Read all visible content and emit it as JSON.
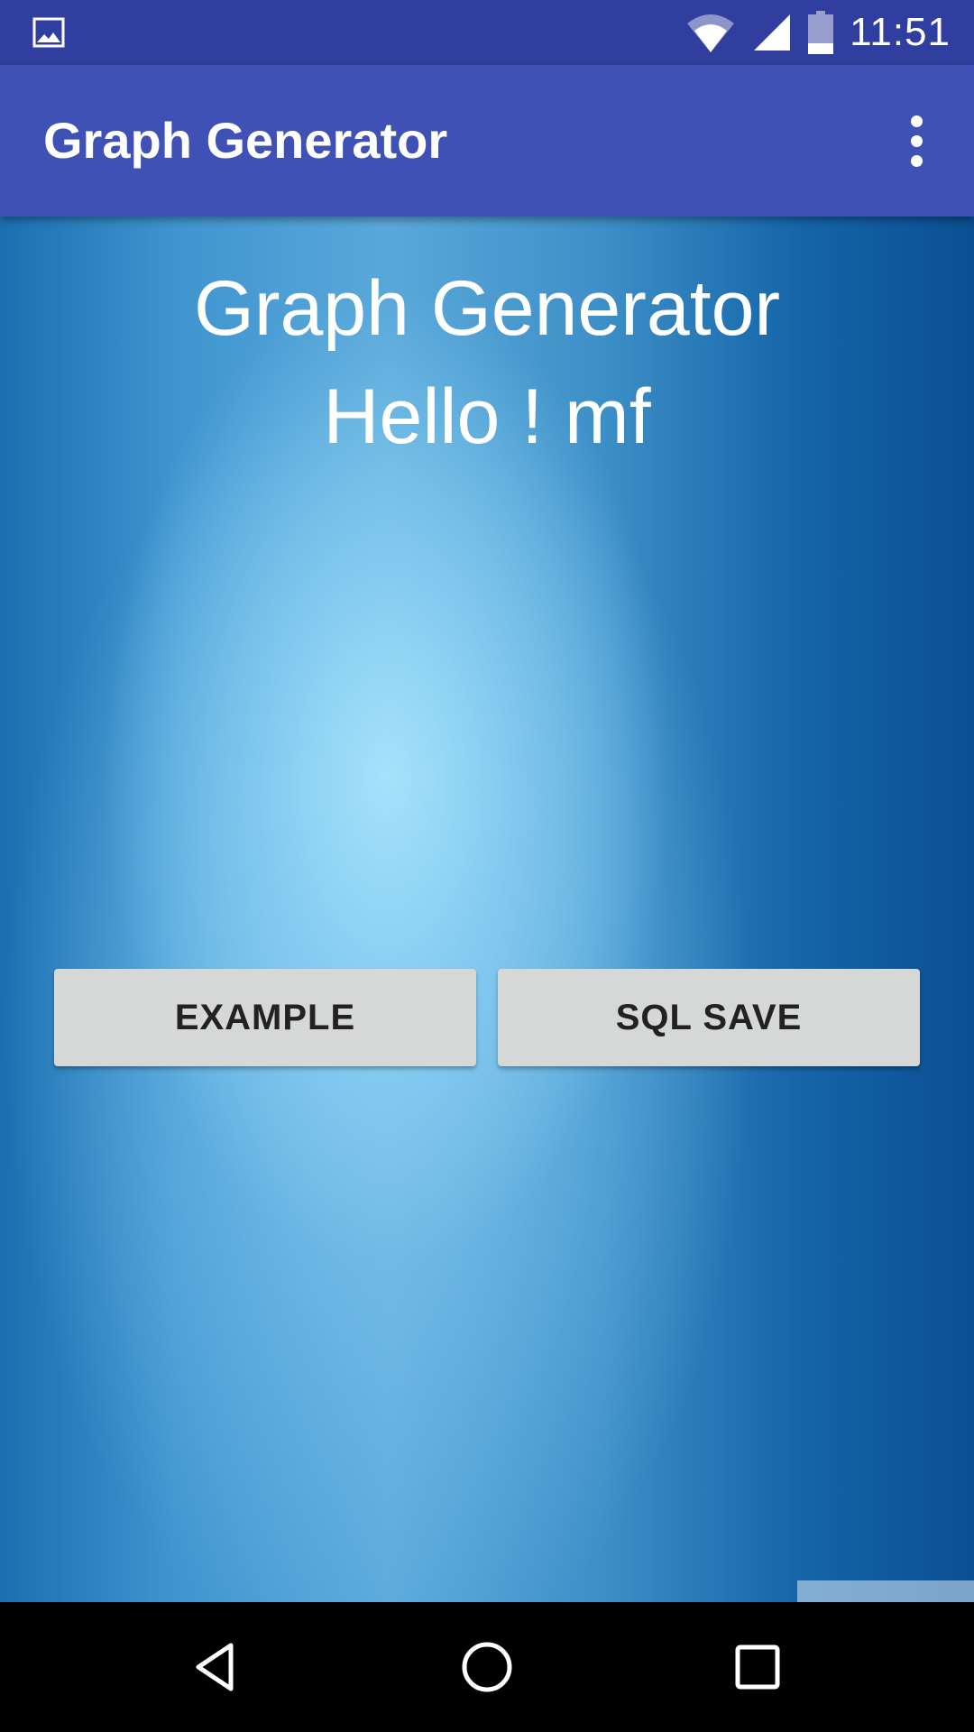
{
  "status_bar": {
    "time": "11:51",
    "notification_icon": "image-icon",
    "wifi_icon": "wifi-icon",
    "signal_icon": "cell-signal-icon",
    "battery_icon": "battery-icon"
  },
  "app_bar": {
    "title": "Graph Generator",
    "menu_icon": "more-vert-icon"
  },
  "main": {
    "title": "Graph Generator",
    "greeting": "Hello ! mf",
    "buttons": {
      "example_label": "EXAMPLE",
      "sql_save_label": "SQL SAVE"
    }
  },
  "nav_bar": {
    "back_icon": "back-icon",
    "home_icon": "home-icon",
    "recents_icon": "recents-icon"
  },
  "colors": {
    "status_bar": "#303f9f",
    "app_bar": "#3f51b5",
    "button": "#d6d7d7",
    "nav_bar": "#000000"
  }
}
